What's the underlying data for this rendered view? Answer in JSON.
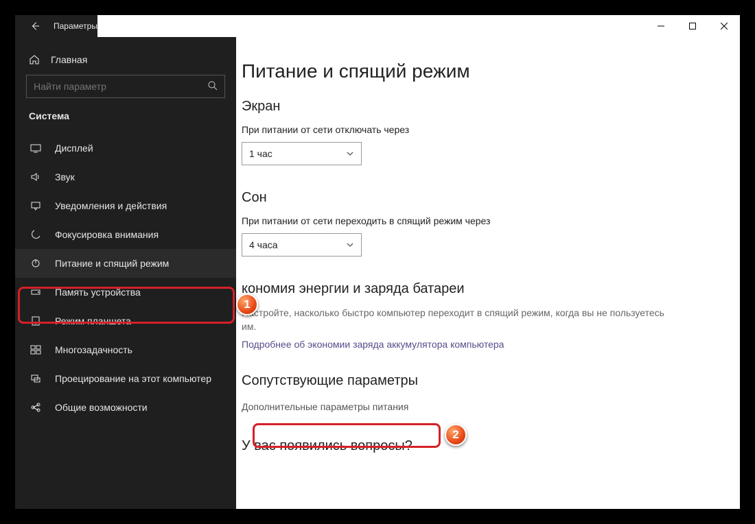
{
  "titlebar": {
    "title": "Параметры"
  },
  "sidebar": {
    "home": "Главная",
    "search_placeholder": "Найти параметр",
    "category": "Система",
    "items": [
      {
        "label": "Дисплей"
      },
      {
        "label": "Звук"
      },
      {
        "label": "Уведомления и действия"
      },
      {
        "label": "Фокусировка внимания"
      },
      {
        "label": "Питание и спящий режим"
      },
      {
        "label": "Память устройства"
      },
      {
        "label": "Режим планшета"
      },
      {
        "label": "Многозадачность"
      },
      {
        "label": "Проецирование на этот компьютер"
      },
      {
        "label": "Общие возможности"
      }
    ]
  },
  "main": {
    "title": "Питание и спящий режим",
    "screen": {
      "heading": "Экран",
      "label": "При питании от сети отключать через",
      "value": "1 час"
    },
    "sleep": {
      "heading": "Сон",
      "label": "При питании от сети переходить в спящий режим через",
      "value": "4 часа"
    },
    "energy": {
      "heading": "кономия энергии и заряда батареи",
      "desc": "Настройте, насколько быстро компьютер переходит в спящий режим, когда вы не пользуетесь им.",
      "link": "Подробнее об экономии заряда аккумулятора компьютера"
    },
    "related": {
      "heading": "Сопутствующие параметры",
      "link": "Дополнительные параметры питания"
    },
    "questions": "У вас появились вопросы?"
  },
  "badges": {
    "one": "1",
    "two": "2"
  }
}
